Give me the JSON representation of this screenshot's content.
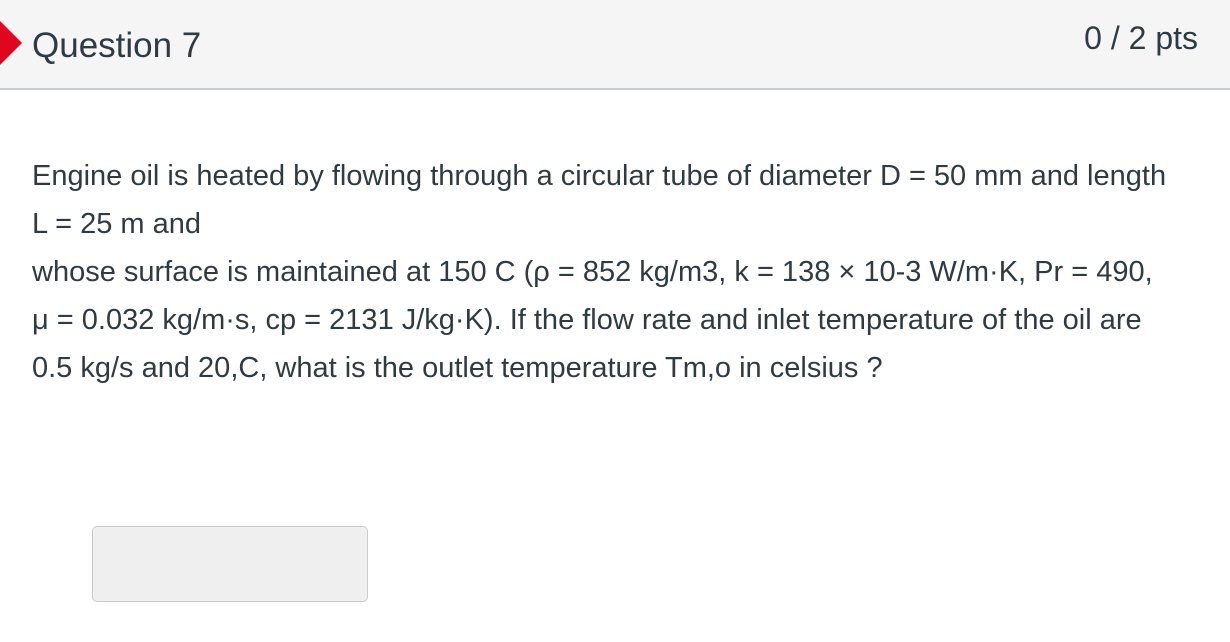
{
  "question": {
    "title": "Question 7",
    "points": "0 / 2 pts",
    "status_color": "#e0061f",
    "body": [
      "Engine oil is heated by flowing through a circular tube of diameter D = 50 mm and length L = 25 m and",
      "whose surface is maintained at 150 C (ρ = 852 kg/m3, k = 138 × 10-3 W/m·K, Pr = 490, μ = 0.032 kg/m·s, cp = 2131 J/kg·K). If the flow rate and inlet temperature of the oil are 0.5 kg/s and 20,C, what is the outlet temperature Tm,o in celsius ?"
    ],
    "answer": {
      "value": "",
      "placeholder": ""
    }
  }
}
